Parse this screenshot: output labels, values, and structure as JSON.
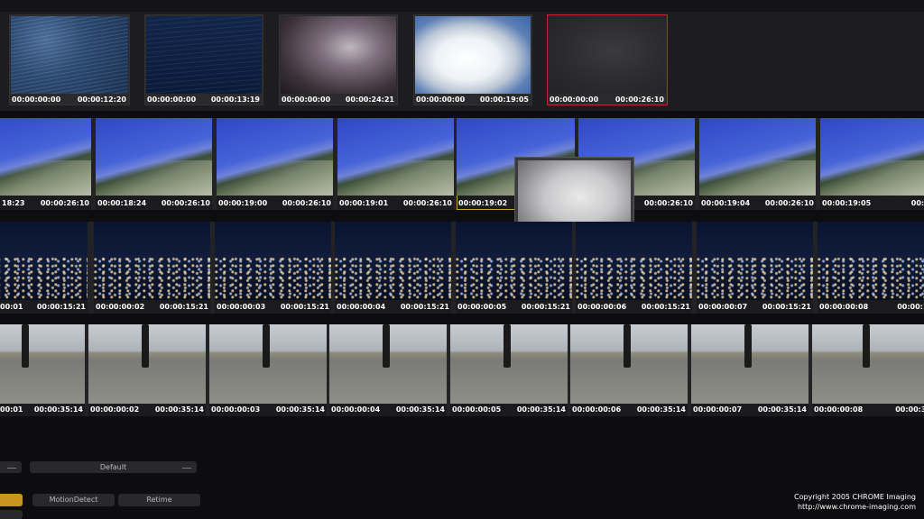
{
  "clip_bins": [
    {
      "in": "00:00:00:00",
      "out": "00:00:12:20",
      "icon": "ocean-thumbnail",
      "selected": false
    },
    {
      "in": "00:00:00:00",
      "out": "00:00:13:19",
      "icon": "dark-ocean-thumbnail",
      "selected": false
    },
    {
      "in": "00:00:00:00",
      "out": "00:00:24:21",
      "icon": "storm-clouds-thumbnail",
      "selected": false
    },
    {
      "in": "00:00:00:00",
      "out": "00:00:19:05",
      "icon": "cumulus-thumbnail",
      "selected": false
    },
    {
      "in": "00:00:00:00",
      "out": "00:00:26:10",
      "icon": "fog-thumbnail",
      "selected": true
    }
  ],
  "strips": [
    {
      "name": "aerial-mountain",
      "frames": [
        {
          "l": "18:23",
          "r": "00:00:26:10"
        },
        {
          "l": "00:00:18:24",
          "r": "00:00:26:10"
        },
        {
          "l": "00:00:19:00",
          "r": "00:00:26:10"
        },
        {
          "l": "00:00:19:01",
          "r": "00:00:26:10"
        },
        {
          "l": "00:00:19:02",
          "r": ""
        },
        {
          "l": "",
          "r": "00:00:26:10"
        },
        {
          "l": "00:00:19:04",
          "r": "00:00:26:10"
        },
        {
          "l": "00:00:19:05",
          "r": "00:00:2"
        }
      ]
    },
    {
      "name": "night-city",
      "frames": [
        {
          "l": "00:01",
          "r": "00:00:15:21"
        },
        {
          "l": "00:00:00:02",
          "r": "00:00:15:21"
        },
        {
          "l": "00:00:00:03",
          "r": "00:00:15:21"
        },
        {
          "l": "00:00:00:04",
          "r": "00:00:15:21"
        },
        {
          "l": "00:00:00:05",
          "r": "00:00:15:21"
        },
        {
          "l": "00:00:00:06",
          "r": "00:00:15:21"
        },
        {
          "l": "00:00:00:07",
          "r": "00:00:15:21"
        },
        {
          "l": "00:00:00:08",
          "r": "00:00:15"
        }
      ]
    },
    {
      "name": "runway",
      "frames": [
        {
          "l": "00:01",
          "r": "00:00:35:14"
        },
        {
          "l": "00:00:00:02",
          "r": "00:00:35:14"
        },
        {
          "l": "00:00:00:03",
          "r": "00:00:35:14"
        },
        {
          "l": "00:00:00:04",
          "r": "00:00:35:14"
        },
        {
          "l": "00:00:00:05",
          "r": "00:00:35:14"
        },
        {
          "l": "00:00:00:06",
          "r": "00:00:35:14"
        },
        {
          "l": "00:00:00:07",
          "r": "00:00:35:14"
        },
        {
          "l": "00:00:00:08",
          "r": "00:00:35"
        }
      ]
    }
  ],
  "controls": {
    "preset": "Default",
    "motion_detect": "MotionDetect",
    "retime": "Retime",
    "accent_color": "#c8961c"
  },
  "copyright": {
    "line1": "Copyright 2005 CHROME Imaging",
    "line2": "http://www.chrome-imaging.com"
  }
}
